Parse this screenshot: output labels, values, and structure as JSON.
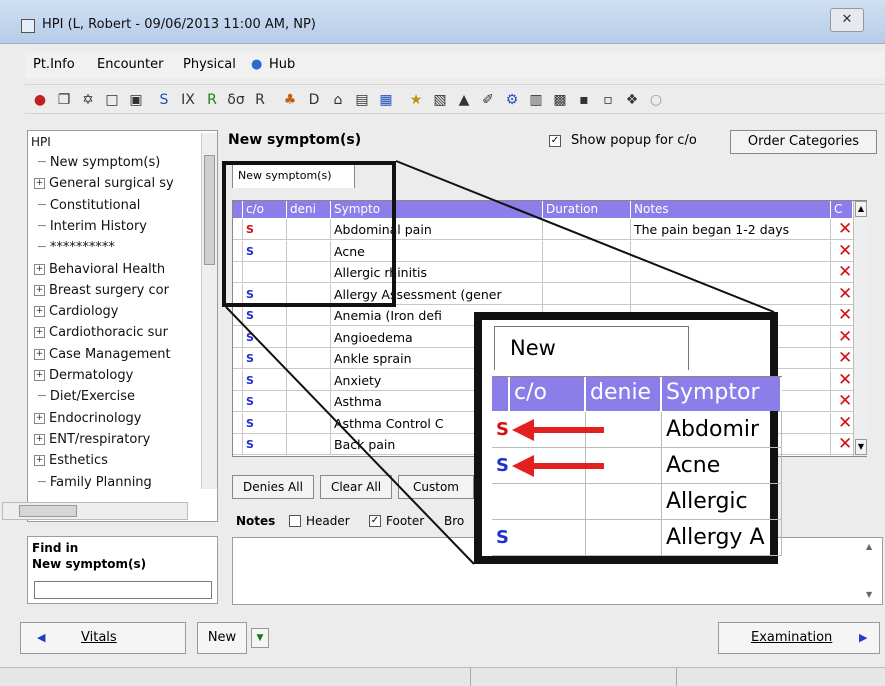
{
  "window": {
    "title": "HPI (L, Robert - 09/06/2013 11:00 AM, NP)",
    "close_glyph": "✕"
  },
  "menu": {
    "items": [
      {
        "label": "Pt.Info"
      },
      {
        "label": "Encounter"
      },
      {
        "label": "Physical"
      },
      {
        "label": "Hub"
      }
    ]
  },
  "toolbar": {
    "glyphs": [
      "●",
      "❐",
      "✡",
      "□",
      "▣",
      "S",
      "IX",
      "R",
      "δσ",
      "R",
      "♣",
      "D",
      "⌂",
      "▤",
      "▦",
      "★",
      "▧",
      "▲",
      "✐",
      "⚙",
      "▥",
      "▩",
      "▪",
      "▫",
      "❖",
      "○"
    ]
  },
  "tree": {
    "root": "HPI",
    "items": [
      {
        "label": "New symptom(s)",
        "expandable": false
      },
      {
        "label": "General surgical sy",
        "expandable": true
      },
      {
        "label": "Constitutional",
        "expandable": false
      },
      {
        "label": "Interim History",
        "expandable": false
      },
      {
        "label": "**********",
        "expandable": false
      },
      {
        "label": "Behavioral Health",
        "expandable": true
      },
      {
        "label": "Breast surgery cor",
        "expandable": true
      },
      {
        "label": "Cardiology",
        "expandable": true
      },
      {
        "label": "Cardiothoracic sur",
        "expandable": true
      },
      {
        "label": "Case Management",
        "expandable": true
      },
      {
        "label": "Dermatology",
        "expandable": true
      },
      {
        "label": "Diet/Exercise",
        "expandable": false
      },
      {
        "label": "Endocrinology",
        "expandable": true
      },
      {
        "label": "ENT/respiratory",
        "expandable": true
      },
      {
        "label": "Esthetics",
        "expandable": true
      },
      {
        "label": "Family Planning",
        "expandable": false
      }
    ]
  },
  "find": {
    "label1": "Find in",
    "label2": "New symptom(s)",
    "value": ""
  },
  "section": {
    "title": "New symptom(s)",
    "show_popup_label": "Show popup for c/o",
    "show_popup_checked": "✓",
    "order_btn": "Order Categories",
    "tab": "New symptom(s)"
  },
  "grid": {
    "headers": {
      "co": "c/o",
      "denies": "deni",
      "symptom": "Sympto",
      "duration": "Duration",
      "notes": "Notes",
      "c": "C"
    },
    "rows": [
      {
        "co": "S",
        "co_color": "#d51010",
        "symptom": "Abdominal pain",
        "notes": "The pain began 1-2 days"
      },
      {
        "co": "S",
        "co_color": "#1f2fd0",
        "symptom": "Acne",
        "notes": ""
      },
      {
        "co": "",
        "co_color": "#1f2fd0",
        "symptom": "Allergic rhinitis",
        "notes": ""
      },
      {
        "co": "S",
        "co_color": "#1f2fd0",
        "symptom": "Allergy Assessment (gener",
        "notes": ""
      },
      {
        "co": "S",
        "co_color": "#1f2fd0",
        "symptom": "Anemia (Iron defi",
        "notes": ""
      },
      {
        "co": "S",
        "co_color": "#1f2fd0",
        "symptom": "Angioedema",
        "notes": ""
      },
      {
        "co": "S",
        "co_color": "#1f2fd0",
        "symptom": "Ankle sprain",
        "notes": ""
      },
      {
        "co": "S",
        "co_color": "#1f2fd0",
        "symptom": "Anxiety",
        "notes": ""
      },
      {
        "co": "S",
        "co_color": "#1f2fd0",
        "symptom": "Asthma",
        "notes": ""
      },
      {
        "co": "S",
        "co_color": "#1f2fd0",
        "symptom": "Asthma Control C",
        "notes": ""
      },
      {
        "co": "S",
        "co_color": "#1f2fd0",
        "symptom": "Back pain",
        "notes": ""
      }
    ],
    "delete_glyph": "✕"
  },
  "buttons": {
    "denies_all": "Denies All",
    "clear_all": "Clear All",
    "custom": "Custom"
  },
  "notes": {
    "label": "Notes",
    "header": "Header",
    "footer": "Footer",
    "bro": "Bro",
    "checked": "✓"
  },
  "nav": {
    "vitals": "Vitals",
    "new": "New",
    "examination": "Examination",
    "left_arrow": "◀",
    "right_arrow": "▶",
    "dropdown": "▼"
  },
  "zoom": {
    "tab": "New symptom(s)",
    "headers": {
      "co": "c/o",
      "denies": "denie",
      "symptom": "Symptor"
    },
    "rows": [
      {
        "co": "S",
        "co_color": "#d51010",
        "symptom": "Abdomir",
        "arrow": true
      },
      {
        "co": "S",
        "co_color": "#1f2fd0",
        "symptom": "Acne",
        "arrow": true
      },
      {
        "co": "",
        "co_color": "#1f2fd0",
        "symptom": "Allergic",
        "arrow": false
      },
      {
        "co": "S",
        "co_color": "#1f2fd0",
        "symptom": "Allergy A",
        "arrow": false
      }
    ]
  },
  "colors": {
    "header_purple": "#8b7ee8",
    "delete_red": "#d51010",
    "arrow_red": "#e32020"
  }
}
